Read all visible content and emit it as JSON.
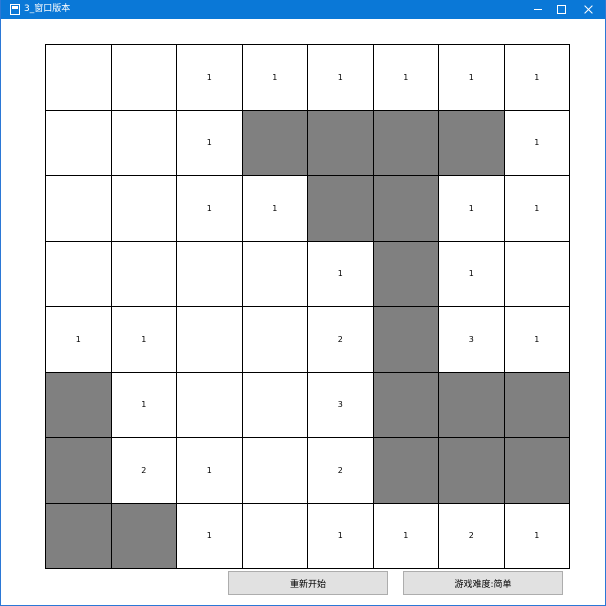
{
  "window": {
    "title": "3_窗口版本"
  },
  "board": {
    "rows": [
      [
        {
          "value": "",
          "hidden": false
        },
        {
          "value": "",
          "hidden": false
        },
        {
          "value": "1",
          "hidden": false
        },
        {
          "value": "1",
          "hidden": false
        },
        {
          "value": "1",
          "hidden": false
        },
        {
          "value": "1",
          "hidden": false
        },
        {
          "value": "1",
          "hidden": false
        },
        {
          "value": "1",
          "hidden": false
        }
      ],
      [
        {
          "value": "",
          "hidden": false
        },
        {
          "value": "",
          "hidden": false
        },
        {
          "value": "1",
          "hidden": false
        },
        {
          "value": "",
          "hidden": true
        },
        {
          "value": "",
          "hidden": true
        },
        {
          "value": "",
          "hidden": true
        },
        {
          "value": "",
          "hidden": true
        },
        {
          "value": "1",
          "hidden": false
        }
      ],
      [
        {
          "value": "",
          "hidden": false
        },
        {
          "value": "",
          "hidden": false
        },
        {
          "value": "1",
          "hidden": false
        },
        {
          "value": "1",
          "hidden": false
        },
        {
          "value": "",
          "hidden": true
        },
        {
          "value": "",
          "hidden": true
        },
        {
          "value": "1",
          "hidden": false
        },
        {
          "value": "1",
          "hidden": false
        }
      ],
      [
        {
          "value": "",
          "hidden": false
        },
        {
          "value": "",
          "hidden": false
        },
        {
          "value": "",
          "hidden": false
        },
        {
          "value": "",
          "hidden": false
        },
        {
          "value": "1",
          "hidden": false
        },
        {
          "value": "",
          "hidden": true
        },
        {
          "value": "1",
          "hidden": false
        },
        {
          "value": "",
          "hidden": false
        }
      ],
      [
        {
          "value": "1",
          "hidden": false
        },
        {
          "value": "1",
          "hidden": false
        },
        {
          "value": "",
          "hidden": false
        },
        {
          "value": "",
          "hidden": false
        },
        {
          "value": "2",
          "hidden": false
        },
        {
          "value": "",
          "hidden": true
        },
        {
          "value": "3",
          "hidden": false
        },
        {
          "value": "1",
          "hidden": false
        }
      ],
      [
        {
          "value": "",
          "hidden": true
        },
        {
          "value": "1",
          "hidden": false
        },
        {
          "value": "",
          "hidden": false
        },
        {
          "value": "",
          "hidden": false
        },
        {
          "value": "3",
          "hidden": false
        },
        {
          "value": "",
          "hidden": true
        },
        {
          "value": "",
          "hidden": true
        },
        {
          "value": "",
          "hidden": true
        }
      ],
      [
        {
          "value": "",
          "hidden": true
        },
        {
          "value": "2",
          "hidden": false
        },
        {
          "value": "1",
          "hidden": false
        },
        {
          "value": "",
          "hidden": false
        },
        {
          "value": "2",
          "hidden": false
        },
        {
          "value": "",
          "hidden": true
        },
        {
          "value": "",
          "hidden": true
        },
        {
          "value": "",
          "hidden": true
        }
      ],
      [
        {
          "value": "",
          "hidden": true
        },
        {
          "value": "",
          "hidden": true
        },
        {
          "value": "1",
          "hidden": false
        },
        {
          "value": "",
          "hidden": false
        },
        {
          "value": "1",
          "hidden": false
        },
        {
          "value": "1",
          "hidden": false
        },
        {
          "value": "2",
          "hidden": false
        },
        {
          "value": "1",
          "hidden": false
        }
      ]
    ]
  },
  "buttons": {
    "restart_label": "重新开始",
    "difficulty_label": "游戏难度:简单"
  },
  "colors": {
    "titlebar": "#0a78d7",
    "hidden_cell": "#808080",
    "revealed_cell": "#ffffff"
  }
}
